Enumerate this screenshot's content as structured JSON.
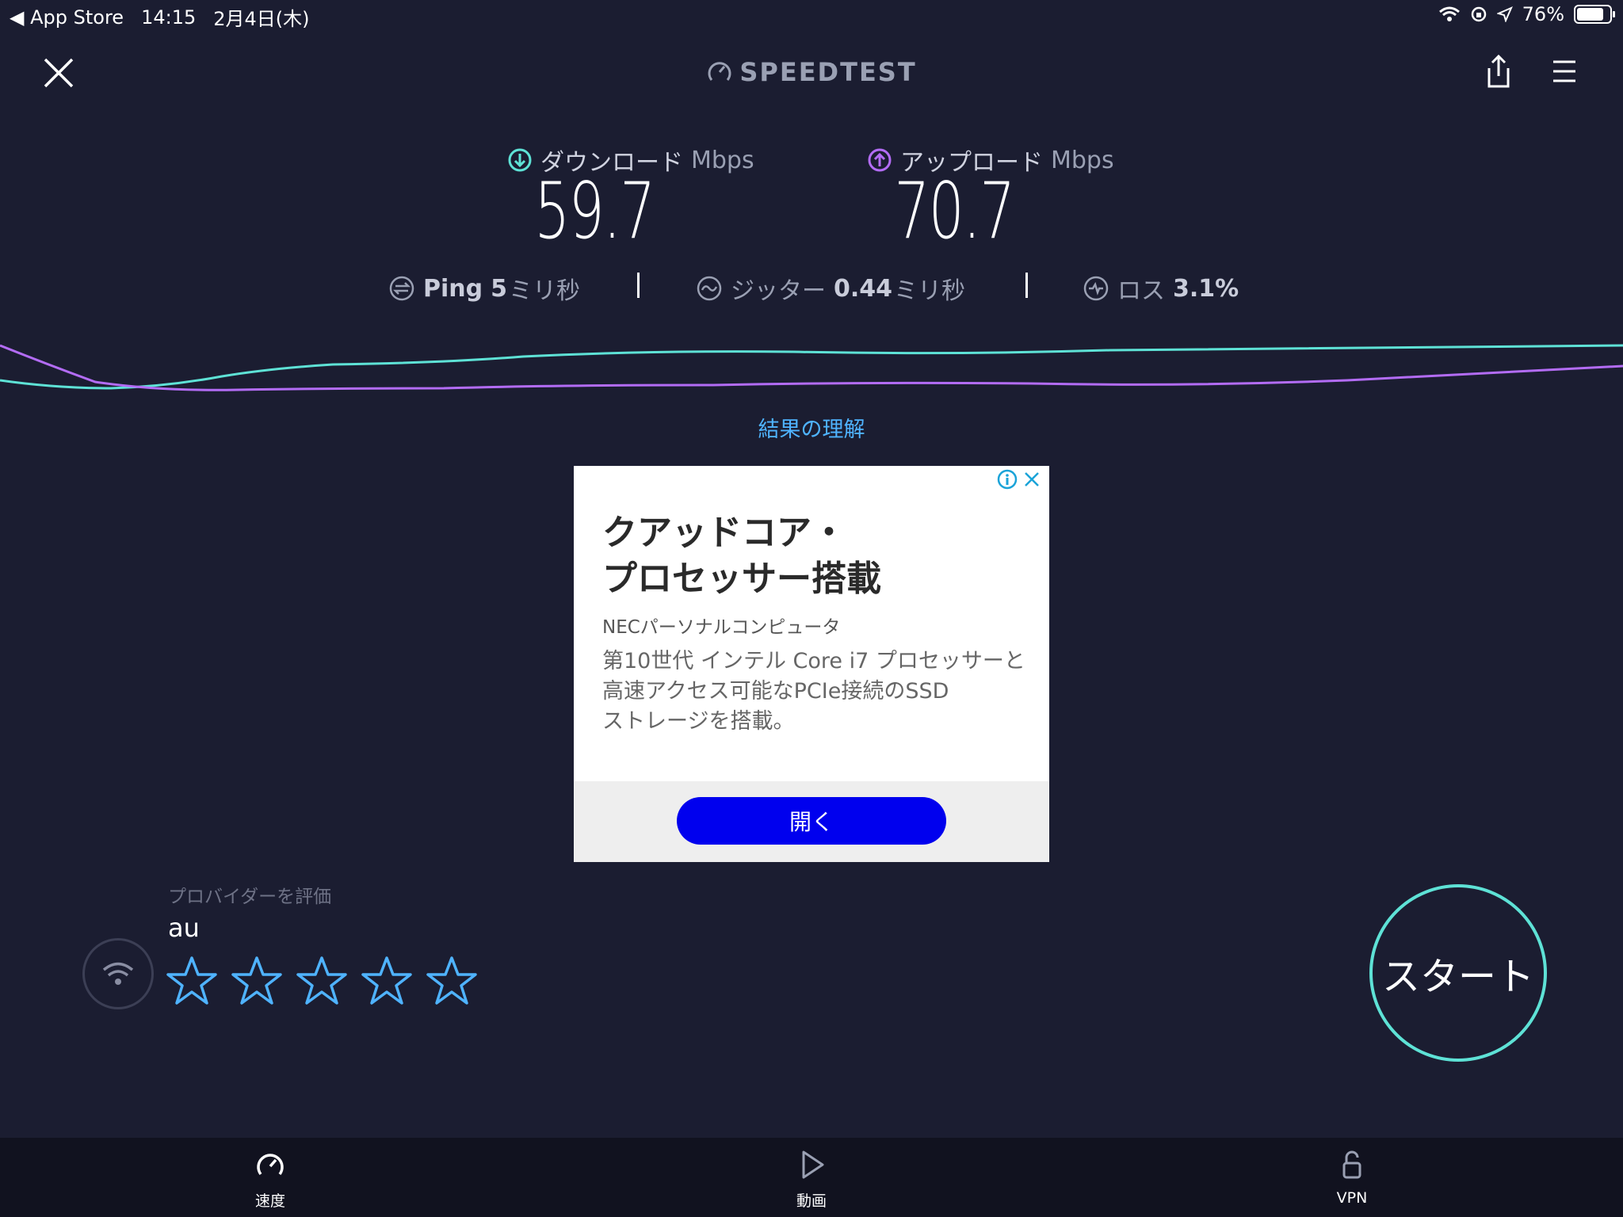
{
  "status_bar": {
    "back_app": "App Store",
    "time": "14:15",
    "date": "2月4日(木)",
    "battery": "76%"
  },
  "header": {
    "logo": "SPEEDTEST"
  },
  "results": {
    "download": {
      "label": "ダウンロード",
      "unit": "Mbps",
      "value": "59.7"
    },
    "upload": {
      "label": "アップロード",
      "unit": "Mbps",
      "value": "70.7"
    },
    "ping": {
      "label": "Ping",
      "value": "5",
      "unit": "ミリ秒"
    },
    "jitter": {
      "label": "ジッター",
      "value": "0.44",
      "unit": "ミリ秒"
    },
    "loss": {
      "label": "ロス",
      "value": "3.1%"
    }
  },
  "understand_link": "結果の理解",
  "ad": {
    "title_line1": "クアッドコア・",
    "title_line2": "プロセッサー搭載",
    "advertiser": "NECパーソナルコンピュータ",
    "desc_line1": "第10世代 インテル Core i7 プロセッサーと",
    "desc_line2": "高速アクセス可能なPCIe接続のSSD",
    "desc_line3": "ストレージを搭載。",
    "cta": "開く"
  },
  "provider": {
    "rate_label": "プロバイダーを評価",
    "name": "au",
    "rating_max": 5,
    "rating_value": 0
  },
  "start_button": "スタート",
  "nav": {
    "speed": "速度",
    "video": "動画",
    "vpn": "VPN"
  },
  "colors": {
    "background": "#1b1d31",
    "download_accent": "#5ee2d6",
    "upload_accent": "#b36cf5",
    "link": "#4fb3ff",
    "cta": "#0000ee"
  }
}
